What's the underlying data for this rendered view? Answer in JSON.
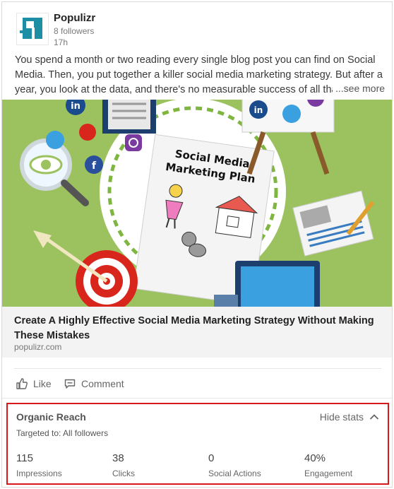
{
  "post": {
    "author_name": "Populizr",
    "followers": "8 followers",
    "age": "17h",
    "text": "You spend a month or two reading every single blog post you can find on Social Media. Then, you put together a killer social media marketing strategy. But after a year, you look at the data, and there's no measurable success of all that",
    "see_more": "...see more"
  },
  "hero": {
    "board_title_line1": "Social Media",
    "board_title_line2": "Marketing Plan"
  },
  "link_preview": {
    "title": "Create A Highly Effective Social Media Marketing Strategy Without Making These Mistakes",
    "domain": "populizr.com"
  },
  "actions": {
    "like": "Like",
    "comment": "Comment"
  },
  "stats": {
    "title": "Organic Reach",
    "targeted": "Targeted to: All followers",
    "hide_label": "Hide stats",
    "items": [
      {
        "value": "115",
        "label": "Impressions"
      },
      {
        "value": "38",
        "label": "Clicks"
      },
      {
        "value": "0",
        "label": "Social Actions"
      },
      {
        "value": "40%",
        "label": "Engagement"
      }
    ]
  },
  "colors": {
    "highlight_border": "#d7191c",
    "hero_background": "#9bc25e",
    "brand_logo": "#1d8ea3"
  }
}
